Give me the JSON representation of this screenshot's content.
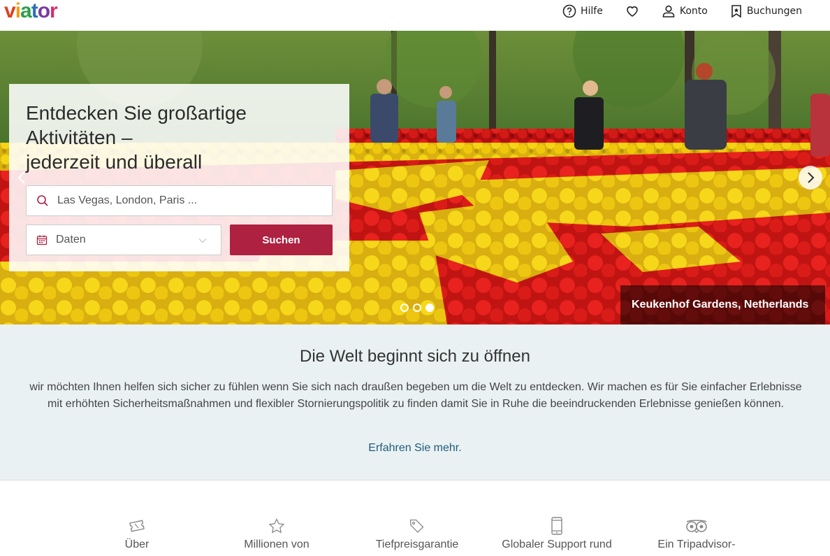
{
  "header": {
    "logo_text": "viator",
    "logo_colors": [
      "#e1401f",
      "#f39c12",
      "#2d9f4b",
      "#2970b8",
      "#7b3aa0",
      "#d62d6b"
    ],
    "nav": [
      {
        "label": "Hilfe",
        "icon": "help-circle-icon"
      },
      {
        "label": "",
        "icon": "heart-icon"
      },
      {
        "label": "Konto",
        "icon": "user-icon"
      },
      {
        "label": "Buchungen",
        "icon": "bookmark-icon"
      }
    ]
  },
  "hero": {
    "title": "Entdecken Sie großartige Aktivitäten – jederzeit und überall",
    "title_lines": [
      "Entdecken Sie großartige",
      "Aktivitäten –",
      "jederzeit und überall"
    ],
    "search_placeholder": "Las Vegas, London, Paris ...",
    "date_label": "Daten",
    "search_button": "Suchen",
    "caption": "Keukenhof Gardens, Netherlands",
    "slides_total": 3,
    "active_slide": 3,
    "accent_color": "#ae2141"
  },
  "banner": {
    "title": "Die Welt beginnt sich zu öffnen",
    "text": "wir möchten Ihnen helfen sich sicher zu fühlen wenn Sie sich nach draußen begeben um die Welt zu entdecken. Wir machen es für Sie einfacher Erlebnisse mit erhöhten Sicherheitsmaßnahmen und flexibler Stornierungspolitik zu finden damit Sie in Ruhe die beeindruckenden Erlebnisse genießen können.",
    "link": "Erfahren Sie mehr."
  },
  "features": [
    {
      "label": "Über",
      "icon": "ticket-icon"
    },
    {
      "label": "Millionen von",
      "icon": "star-icon"
    },
    {
      "label": "Tiefpreisgarantie",
      "icon": "price-tag-icon"
    },
    {
      "label": "Globaler Support rund",
      "icon": "smartphone-icon"
    },
    {
      "label": "Ein Tripadvisor-",
      "icon": "tripadvisor-owl-icon"
    }
  ]
}
